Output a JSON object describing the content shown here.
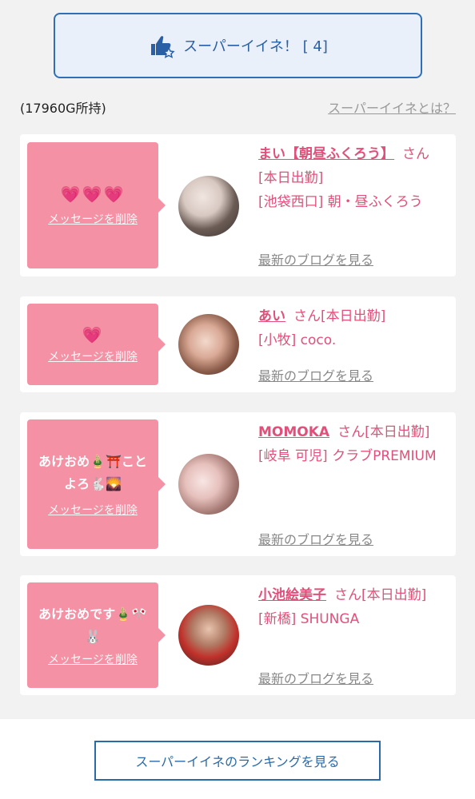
{
  "super_button": {
    "label": "スーパーイイネ！ [ 4]"
  },
  "balance": "(17960G所持)",
  "what_link": "スーパーイイネとは？",
  "delete_label": "メッセージを削除",
  "blog_label": "最新のブログを見る",
  "ranking_button": "スーパーイイネのランキングを見る",
  "cards": [
    {
      "message": "💗💗💗",
      "name": "まい【朝昼ふくろう】",
      "suffix": "さん[本日出勤]",
      "shop": "[池袋西口] 朝・昼ふくろう"
    },
    {
      "message": "💗",
      "name": "あい",
      "suffix": "さん[本日出勤]",
      "shop": "[小牧] coco."
    },
    {
      "message": "あけおめ🎍⛩️ことよろ🐇🌄",
      "name": "MOMOKA",
      "suffix": "さん[本日出勤]",
      "shop": "[岐阜 可児] クラブPREMIUM"
    },
    {
      "message": "あけおめです🎍🎌🐰",
      "name": "小池絵美子",
      "suffix": "さん[本日出勤]",
      "shop": "[新橋] SHUNGA"
    }
  ]
}
